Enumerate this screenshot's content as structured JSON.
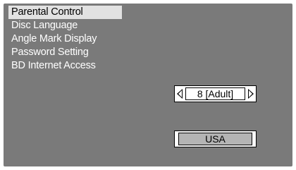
{
  "menu": {
    "items": [
      {
        "label": "Parental Control",
        "selected": true
      },
      {
        "label": "Disc Language",
        "selected": false
      },
      {
        "label": "Angle Mark Display",
        "selected": false
      },
      {
        "label": "Password Setting",
        "selected": false
      },
      {
        "label": "BD Internet Access",
        "selected": false
      }
    ]
  },
  "parental_level": {
    "value": "8 [Adult]",
    "left_icon": "triangle-left-icon",
    "right_icon": "triangle-right-icon"
  },
  "country_code": {
    "value": "USA"
  },
  "colors": {
    "background": "#7a7a7a",
    "selected_item_bg": "#e2e2e2",
    "menu_text": "#ffffff",
    "country_field_bg": "#b4b4b4"
  }
}
